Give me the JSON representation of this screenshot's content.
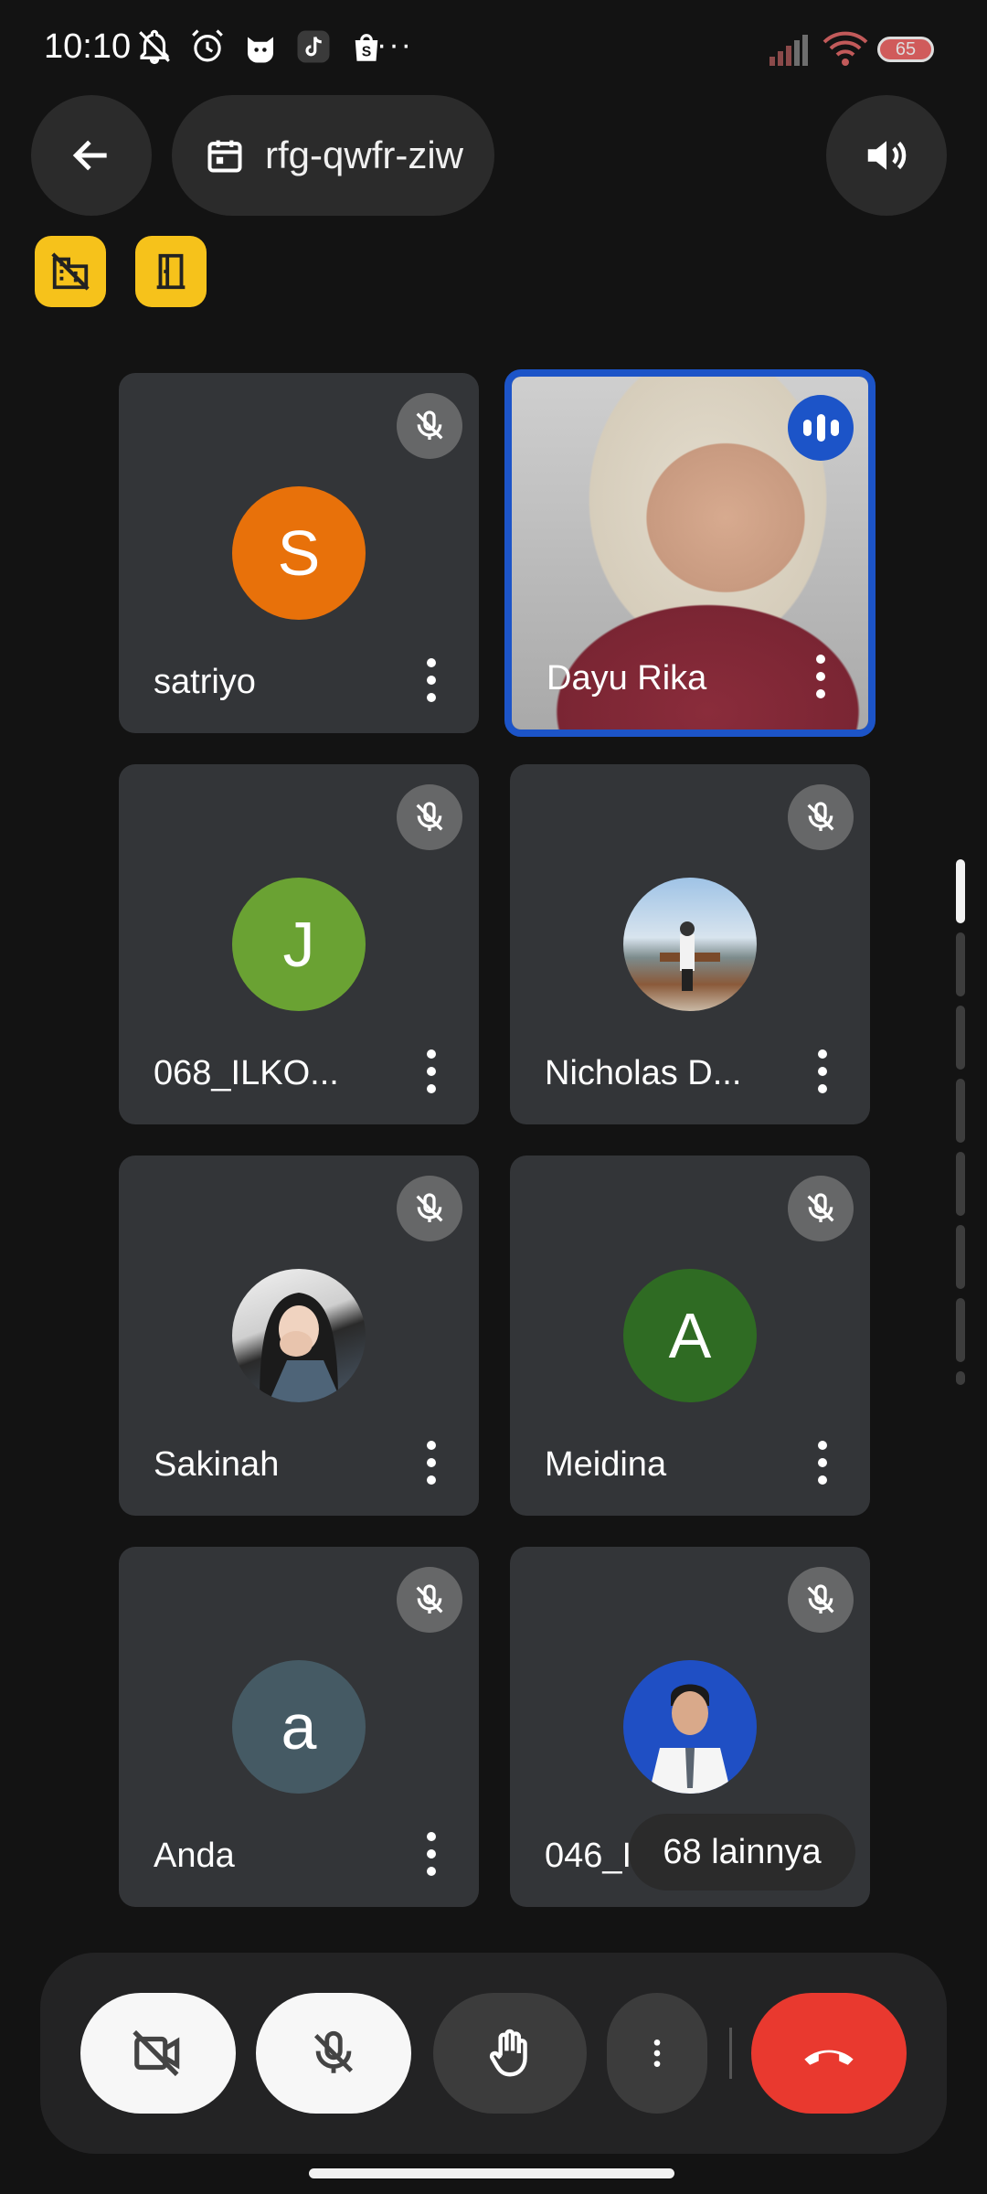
{
  "status_bar": {
    "time": "10:10",
    "battery": "65",
    "more": "···"
  },
  "header": {
    "meeting_code": "rfg-qwfr-ziw"
  },
  "participants": [
    {
      "name": "satriyo",
      "initial": "S",
      "avatar_color": "#e8710a",
      "muted": true
    },
    {
      "name": "Dayu Rika",
      "video": true,
      "speaking": true
    },
    {
      "name": "068_ILKO...",
      "initial": "J",
      "avatar_color": "#6aa233",
      "muted": true
    },
    {
      "name": "Nicholas D...",
      "photo": true,
      "muted": true
    },
    {
      "name": "Sakinah",
      "photo": true,
      "muted": true
    },
    {
      "name": "Meidina",
      "initial": "A",
      "avatar_color": "#2f6b23",
      "muted": true
    },
    {
      "name": "Anda",
      "initial": "a",
      "avatar_color": "#455a64",
      "muted": true
    },
    {
      "name": "046_IL...",
      "photo": true,
      "muted": true
    }
  ],
  "more_participants": "68 lainnya",
  "colors": {
    "accent_blue": "#1c54c8",
    "end_call_red": "#e9392f",
    "badge_yellow": "#f6c21b"
  }
}
